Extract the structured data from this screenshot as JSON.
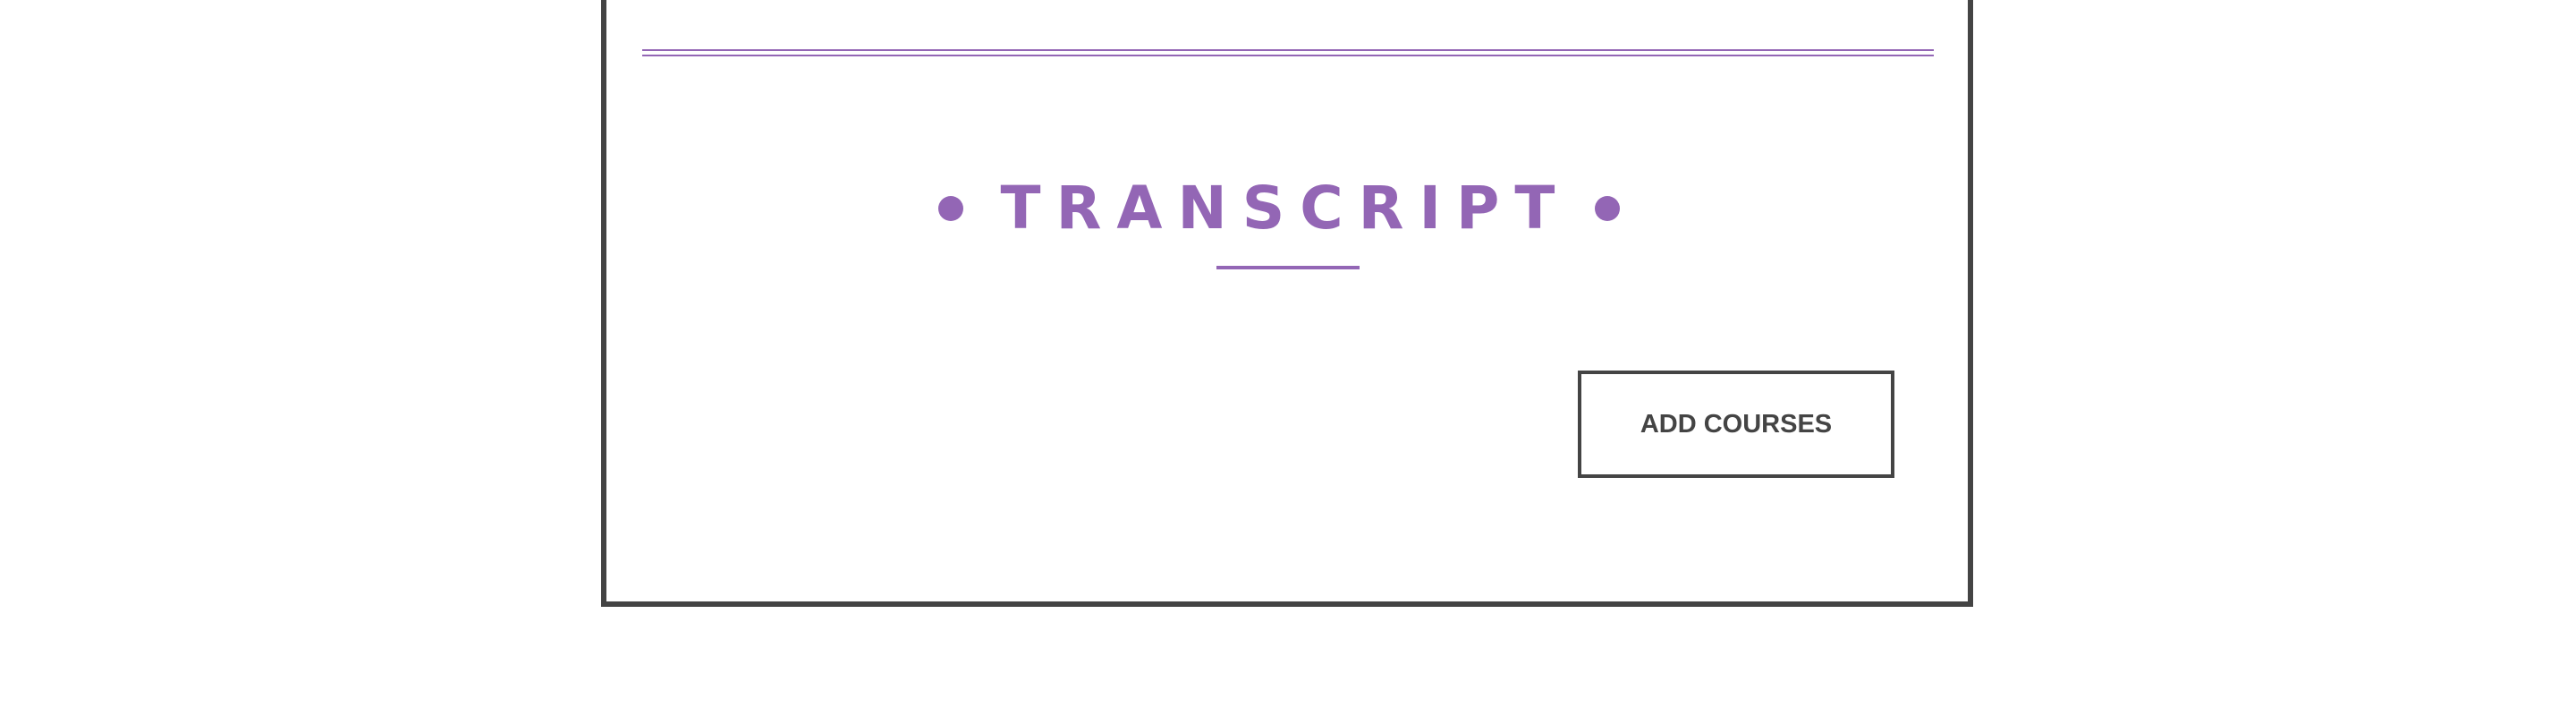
{
  "colors": {
    "accent": "#9366b5",
    "border": "#444444",
    "background": "#ffffff"
  },
  "section": {
    "title": "TRANSCRIPT"
  },
  "actions": {
    "add_courses_label": "ADD COURSES"
  }
}
